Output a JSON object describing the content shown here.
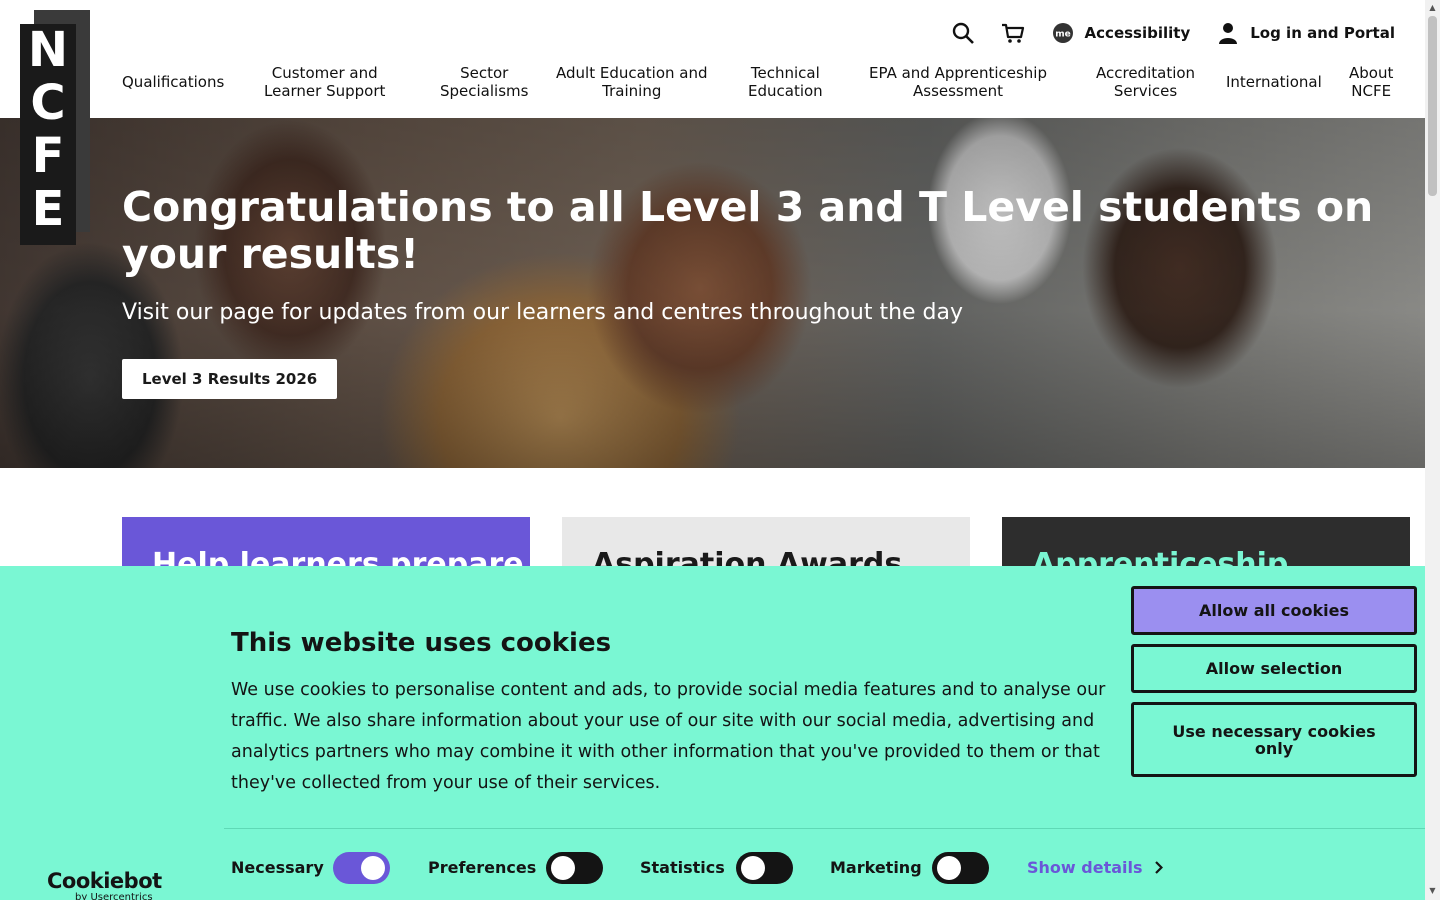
{
  "header": {
    "logo_letters": [
      "N",
      "C",
      "F",
      "E"
    ],
    "utility": {
      "search_icon": "search-icon",
      "basket_icon": "basket-icon",
      "accessibility_icon": "recite-me-icon",
      "accessibility_label": "Accessibility",
      "account_icon": "user-icon",
      "login_label": "Log in and Portal"
    },
    "nav": [
      {
        "label": "Qualifications"
      },
      {
        "label": "Customer and\nLearner Support"
      },
      {
        "label": "Sector\nSpecialisms"
      },
      {
        "label": "Adult Education and\nTraining"
      },
      {
        "label": "Technical\nEducation"
      },
      {
        "label": "EPA and Apprenticeship\nAssessment"
      },
      {
        "label": "Accreditation\nServices"
      },
      {
        "label": "International"
      },
      {
        "label": "About\nNCFE"
      }
    ]
  },
  "hero": {
    "title": "Congratulations to all Level 3 and T Level students on your results!",
    "subtitle": "Visit our page for updates from our learners and centres throughout the day",
    "button_label": "Level 3 Results 2026"
  },
  "cards": [
    {
      "title": "Help learners prepare",
      "color": "#6a57d8"
    },
    {
      "title": "Aspiration Awards",
      "color": "#e8e8e8"
    },
    {
      "title": "Apprenticeship",
      "color": "#2d2d2d"
    }
  ],
  "cookie_banner": {
    "background": "#7af7d3",
    "title": "This website uses cookies",
    "body": "We use cookies to personalise content and ads, to provide social media features and to analyse our traffic. We also share information about your use of our site with our social media, advertising and analytics partners who may combine it with other information that you've provided to them or that they've collected from your use of their services.",
    "buttons": {
      "allow_all": "Allow all cookies",
      "allow_selection": "Allow selection",
      "necessary_only": "Use necessary cookies only"
    },
    "toggles": [
      {
        "label": "Necessary",
        "on": true
      },
      {
        "label": "Preferences",
        "on": false
      },
      {
        "label": "Statistics",
        "on": false
      },
      {
        "label": "Marketing",
        "on": false
      }
    ],
    "show_details": "Show details",
    "branding": {
      "name": "Cookiebot",
      "by": "by Usercentrics"
    }
  }
}
